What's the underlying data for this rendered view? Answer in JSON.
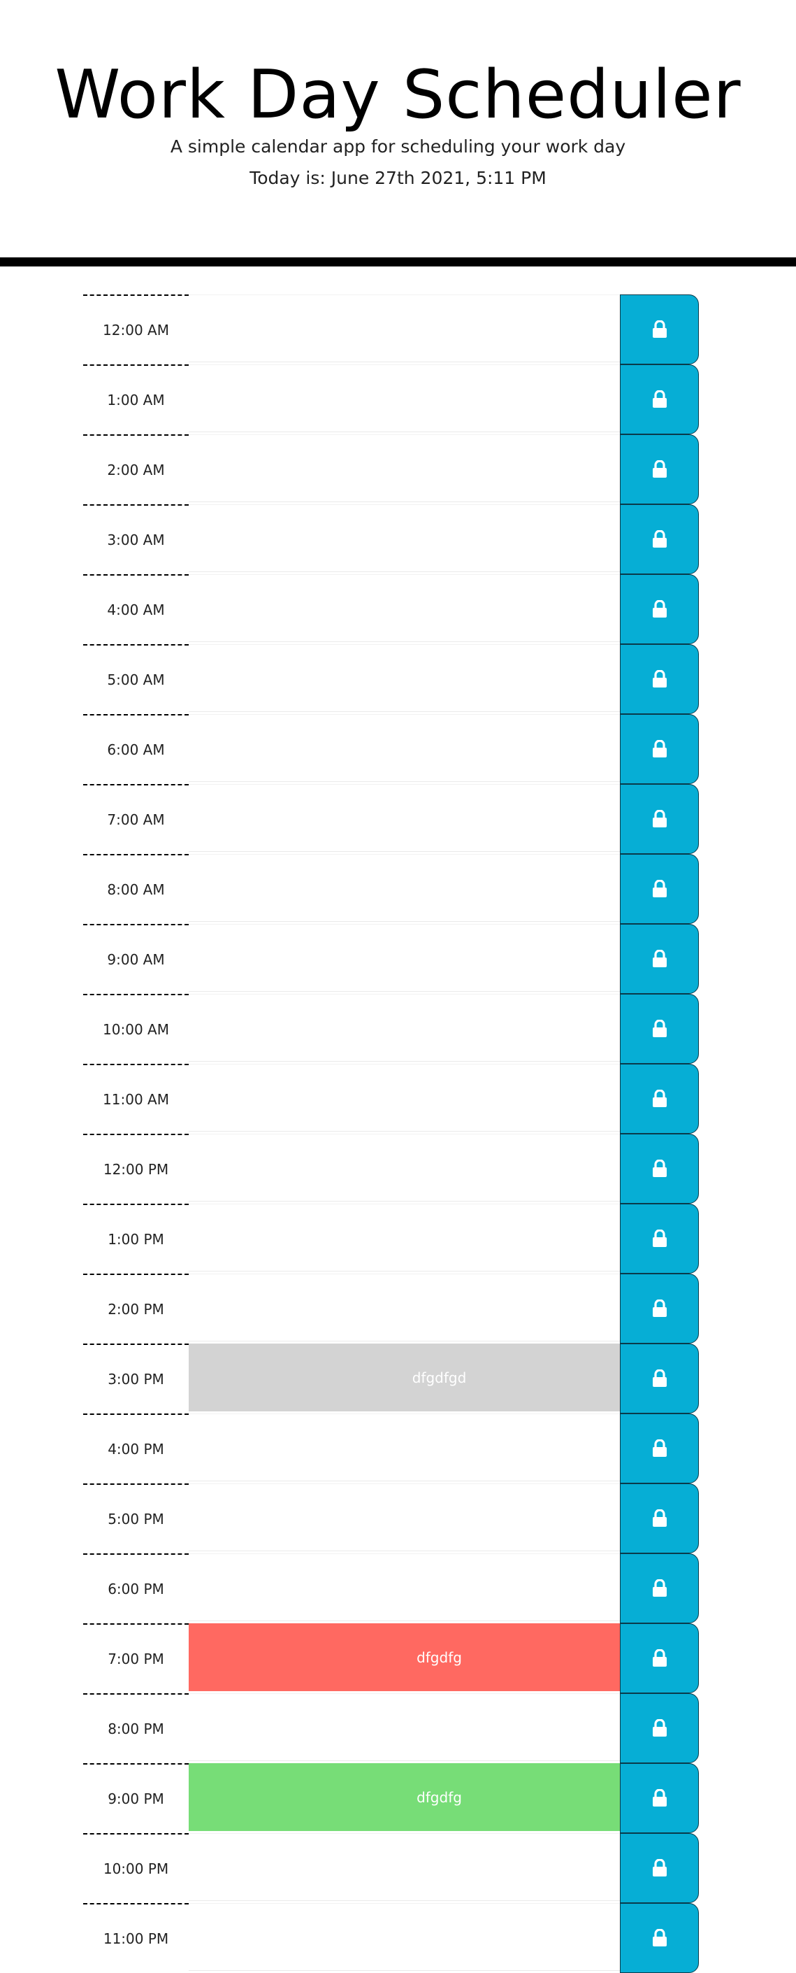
{
  "header": {
    "title": "Work Day Scheduler",
    "subtitle": "A simple calendar app for scheduling your work day",
    "today": "Today is: June 27th 2021, 5:11 PM"
  },
  "colors": {
    "save_button": "#06aed5",
    "past": "#d3d3d3",
    "present": "#ff6961",
    "future": "#77dd77"
  },
  "rows": [
    {
      "hour": "12:00 AM",
      "text": "",
      "state": ""
    },
    {
      "hour": "1:00 AM",
      "text": "",
      "state": ""
    },
    {
      "hour": "2:00 AM",
      "text": "",
      "state": ""
    },
    {
      "hour": "3:00 AM",
      "text": "",
      "state": ""
    },
    {
      "hour": "4:00 AM",
      "text": "",
      "state": ""
    },
    {
      "hour": "5:00 AM",
      "text": "",
      "state": ""
    },
    {
      "hour": "6:00 AM",
      "text": "",
      "state": ""
    },
    {
      "hour": "7:00 AM",
      "text": "",
      "state": ""
    },
    {
      "hour": "8:00 AM",
      "text": "",
      "state": ""
    },
    {
      "hour": "9:00 AM",
      "text": "",
      "state": ""
    },
    {
      "hour": "10:00 AM",
      "text": "",
      "state": ""
    },
    {
      "hour": "11:00 AM",
      "text": "",
      "state": ""
    },
    {
      "hour": "12:00 PM",
      "text": "",
      "state": ""
    },
    {
      "hour": "1:00 PM",
      "text": "",
      "state": ""
    },
    {
      "hour": "2:00 PM",
      "text": "",
      "state": ""
    },
    {
      "hour": "3:00 PM",
      "text": "dfgdfgd",
      "state": "past"
    },
    {
      "hour": "4:00 PM",
      "text": "",
      "state": ""
    },
    {
      "hour": "5:00 PM",
      "text": "",
      "state": ""
    },
    {
      "hour": "6:00 PM",
      "text": "",
      "state": ""
    },
    {
      "hour": "7:00 PM",
      "text": "dfgdfg",
      "state": "present"
    },
    {
      "hour": "8:00 PM",
      "text": "",
      "state": ""
    },
    {
      "hour": "9:00 PM",
      "text": "dfgdfg",
      "state": "future"
    },
    {
      "hour": "10:00 PM",
      "text": "",
      "state": ""
    },
    {
      "hour": "11:00 PM",
      "text": "",
      "state": ""
    }
  ],
  "save_icon": "lock-icon"
}
